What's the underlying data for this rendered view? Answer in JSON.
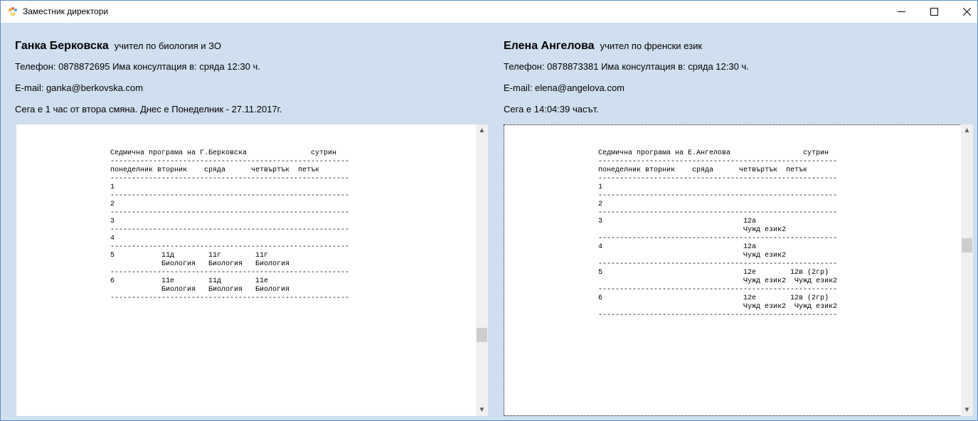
{
  "window": {
    "title": "Заместник директори"
  },
  "left": {
    "name": "Ганка Берковска",
    "role": "учител по биология и ЗО",
    "phone_line": "Телефон:  0878872695    Има консултация в: сряда 12:30 ч.",
    "email_line": "E-mail: ganka@berkovska.com",
    "status_line": "Сега е 1 час от  втора смяна. Днес е Понеделник - 27.11.2017г.",
    "schedule_text": "Седмична програма на Г.Берковска               сутрин\n--------------------------------------------------------\nпонеделник вторник    сряда      четвъртък  петък\n--------------------------------------------------------\n1\n--------------------------------------------------------\n2\n--------------------------------------------------------\n3\n--------------------------------------------------------\n4\n--------------------------------------------------------\n5           11д        11г        11г\n            Биология   Биология   Биология\n--------------------------------------------------------\n6           11е        11д        11е\n            Биология   Биология   Биология\n--------------------------------------------------------"
  },
  "right": {
    "name": "Елена Ангелова",
    "role": "учител по френски език",
    "phone_line": "Телефон:  0878873381    Има консултация в: сряда 12:30 ч.",
    "email_line": "E-mail: elena@angelova.com",
    "status_line": "Сега е 14:04:39 часът.",
    "schedule_text": "Седмична програма на Е.Ангелова                 сутрин\n--------------------------------------------------------\nпонеделник вторник    сряда      четвъртък  петък\n--------------------------------------------------------\n1\n--------------------------------------------------------\n2\n--------------------------------------------------------\n3                                 12а\n                                  Чужд език2\n--------------------------------------------------------\n4                                 12а\n                                  Чужд език2\n--------------------------------------------------------\n5                                 12е        12в (2гр)\n                                  Чужд език2  Чужд език2\n--------------------------------------------------------\n6                                 12е        12в (2гр)\n                                  Чужд език2  Чужд език2\n--------------------------------------------------------"
  }
}
